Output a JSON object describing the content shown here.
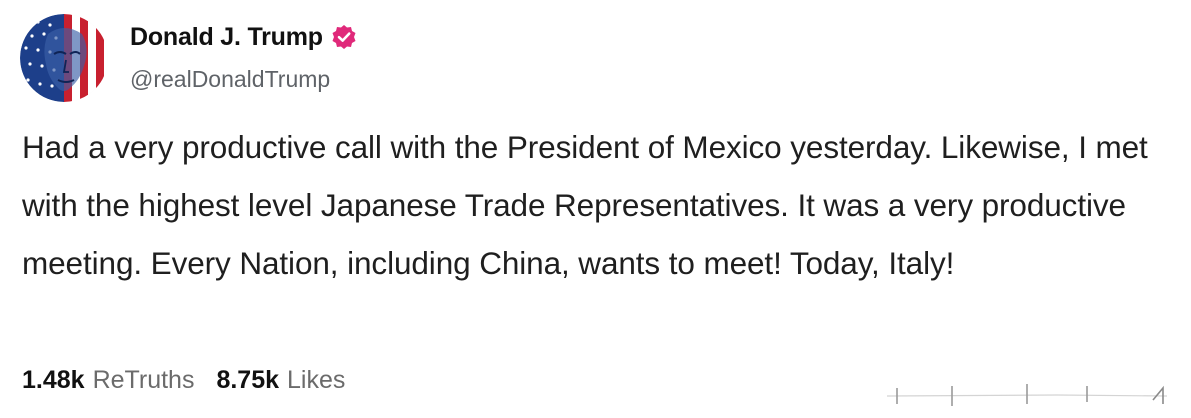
{
  "author": {
    "display_name": "Donald J. Trump",
    "handle": "@realDonaldTrump",
    "verified": true,
    "verified_color": "#e0297a",
    "avatar_icon": "flag-portrait-avatar"
  },
  "post": {
    "text": "Had a very productive call with the President of Mexico yesterday. Likewise, I met with the highest level Japanese Trade Representatives. It was a very productive meeting. Every Nation, including China, wants to meet! Today, Italy!"
  },
  "stats": {
    "retruths_count": "1.48k",
    "retruths_label": "ReTruths",
    "likes_count": "8.75k",
    "likes_label": "Likes"
  },
  "colors": {
    "text": "#1f1f1f",
    "muted": "#6b6b6b",
    "background": "#ffffff"
  }
}
